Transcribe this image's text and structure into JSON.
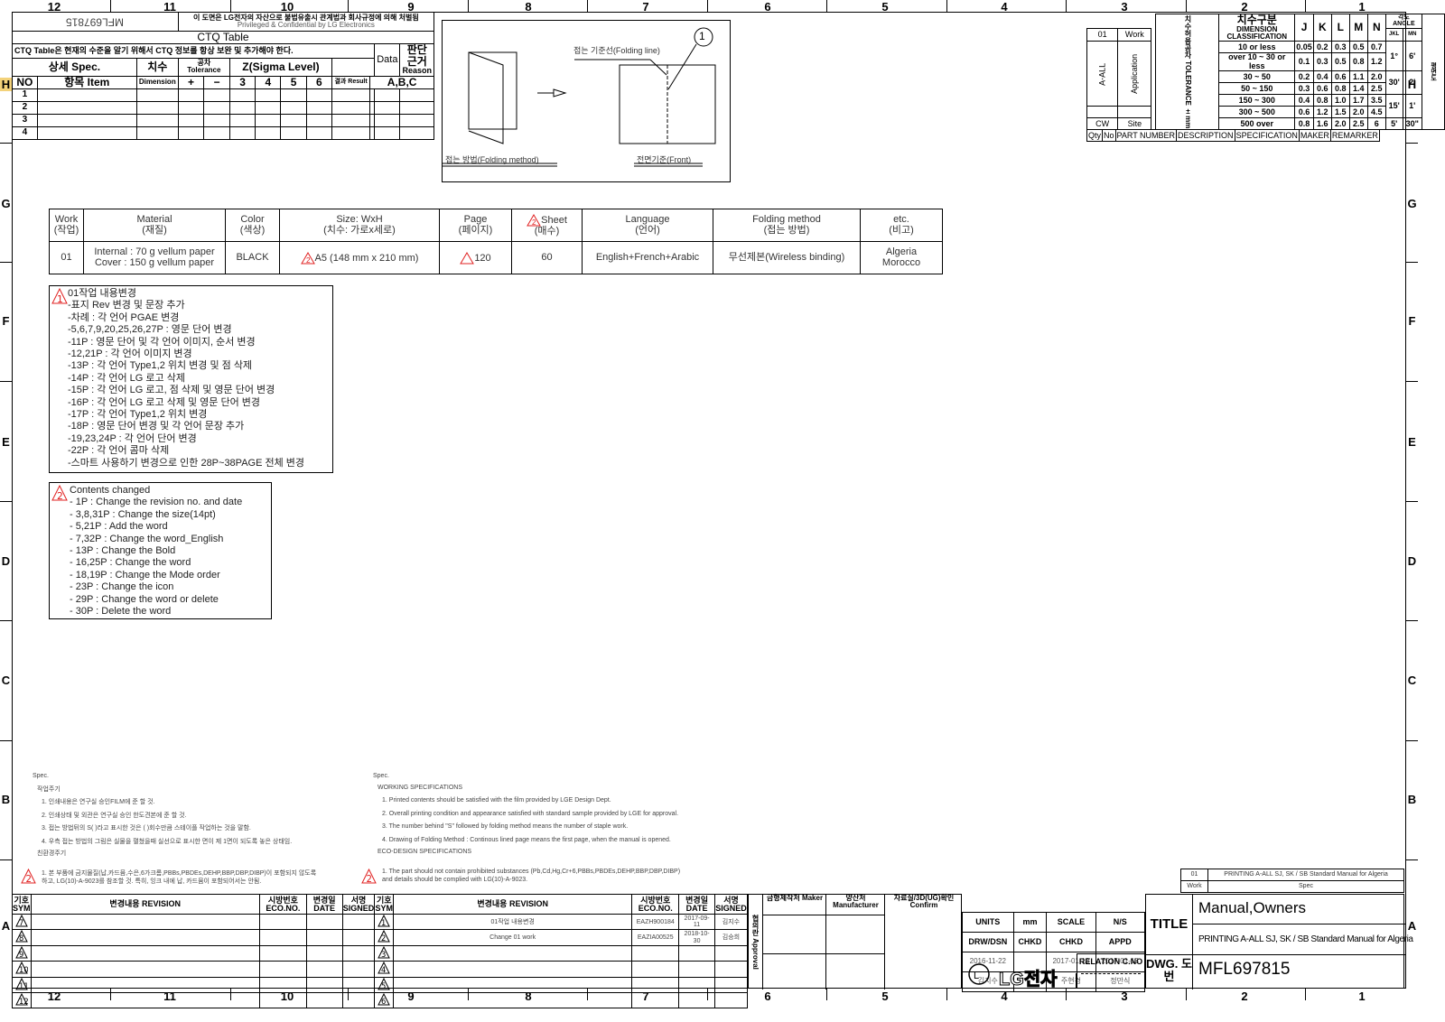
{
  "border": {
    "columns": [
      "12",
      "11",
      "10",
      "9",
      "8",
      "7",
      "6",
      "5",
      "4",
      "3",
      "2",
      "1"
    ],
    "rows": [
      "H",
      "G",
      "F",
      "E",
      "D",
      "C",
      "B",
      "A"
    ]
  },
  "ctq": {
    "drawing_no_mirrored": "MFL697815",
    "notice_ko": "이 도면은 LG전자의 자산으로 불법유출시 관계법과 회사규정에 의해 처벌됨",
    "notice_en": "Privileged & Confidential by LG Electronics",
    "title": "CTQ Table",
    "instruction": "CTQ Table은 현재의 수준을 알기 위해서 CTQ 정보를 항상 보완 및 추가해야 한다.",
    "data": "Data",
    "reason_ko": "판단근거",
    "reason_en": "Reason",
    "detail_spec": "상세 Spec.",
    "dim_ko": "치수",
    "tolerance": "공차 Tolerance",
    "sigma": "Z(Sigma Level)",
    "no": "NO",
    "item": "항목 Item",
    "dimension": "Dimension",
    "plus": "+",
    "minus": "−",
    "s3": "3",
    "s4": "4",
    "s5": "5",
    "s6": "6",
    "result": "결과 Result",
    "abc": "A,B,C",
    "rows": [
      "1",
      "2",
      "3",
      "4"
    ]
  },
  "folding": {
    "line_label": "접는 기준선(Folding line)",
    "callout": "1",
    "method_label": "접는 방법(Folding method)",
    "front_label": "전면기준(Front)"
  },
  "tolerance": {
    "work_no": "01",
    "work": "Work",
    "a_all": "A-ALL",
    "application": "Application",
    "cw": "CW",
    "site": "Site",
    "tol_ko": "치수허용공차",
    "tol_en": "TOLERANCE",
    "unit": "±mm",
    "dim_ko": "치수구분",
    "dim_en": "DIMENSION CLASSIFICATION",
    "grades": [
      "J",
      "K",
      "L",
      "M",
      "N"
    ],
    "angle": "각도 ANGLE",
    "angle_sub": [
      "JKL",
      "MN"
    ],
    "flat": "평면도",
    "ranges": [
      {
        "range": "10 or less",
        "v": [
          "0.05",
          "0.2",
          "0.3",
          "0.5",
          "0.7"
        ]
      },
      {
        "range": "over 10 ~ 30 or less",
        "v": [
          "0.1",
          "0.3",
          "0.5",
          "0.8",
          "1.2"
        ]
      },
      {
        "range": "30 ~ 50",
        "v": [
          "0.2",
          "0.4",
          "0.6",
          "1.1",
          "2.0"
        ]
      },
      {
        "range": "50 ~ 150",
        "v": [
          "0.3",
          "0.6",
          "0.8",
          "1.4",
          "2.5"
        ]
      },
      {
        "range": "150 ~ 300",
        "v": [
          "0.4",
          "0.8",
          "1.0",
          "1.7",
          "3.5"
        ]
      },
      {
        "range": "300 ~ 500",
        "v": [
          "0.6",
          "1.2",
          "1.5",
          "2.0",
          "4.5"
        ]
      },
      {
        "range": "500 over",
        "v": [
          "0.8",
          "1.6",
          "2.0",
          "2.5",
          "6"
        ]
      }
    ],
    "angles": [
      [
        "1°",
        "6'"
      ],
      [
        "30'",
        "2'"
      ],
      [
        "15'",
        "1'"
      ],
      [
        "5'",
        "30\""
      ]
    ],
    "footer": [
      "Qty",
      "No",
      "PART NUMBER",
      "DESCRIPTION",
      "SPECIFICATION",
      "MAKER",
      "REMARKER"
    ]
  },
  "spec_table": {
    "headers": [
      [
        "Work",
        "(작업)"
      ],
      [
        "Material",
        "(재질)"
      ],
      [
        "Color",
        "(색상)"
      ],
      [
        "Size: WxH",
        "(치수: 가로x세로)"
      ],
      [
        "Page",
        "(페이지)"
      ],
      [
        "Sheet",
        "(매수)"
      ],
      [
        "Language",
        "(언어)"
      ],
      [
        "Folding method",
        "(접는 방법)"
      ],
      [
        "etc.",
        "(비고)"
      ]
    ],
    "row": {
      "work": "01",
      "material": [
        "Internal : 70 g vellum paper",
        "Cover : 150 g vellum paper"
      ],
      "color": "BLACK",
      "size": "A5 (148 mm x 210 mm)",
      "page": "120",
      "sheet": "60",
      "language": "English+French+Arabic",
      "folding": "무선제본(Wireless binding)",
      "etc": [
        "Algeria",
        "Morocco"
      ]
    }
  },
  "changes_ko": {
    "rev": "1",
    "title": "01작업 내용변경",
    "items": [
      "-표지 Rev 변경 및 문장 추가",
      "-차례 : 각 언어 PGAE 변경",
      "-5,6,7,9,20,25,26,27P : 영문 단어 변경",
      "-11P : 영문 단어 및 각 언어 이미지, 순서 변경",
      "-12,21P : 각 언어 이미지 변경",
      "-13P : 각 언어 Type1,2 위치 변경 및 점 삭제",
      "-14P : 각 언어 LG 로고 삭제",
      "-15P : 각 언어 LG 로고, 점 삭제 및 영문 단어 변경",
      "-16P : 각 언어 LG 로고 삭제 및 영문 단어 변경",
      "-17P : 각 언어 Type1,2 위치 변경",
      "-18P : 영문 단어 변경 및 각 언어 문장 추가",
      "-19,23,24P : 각 언어 단어 변경",
      "-22P : 각 언어 콤마 삭제",
      "-스마트 사용하기 변경으로 인한 28P~38PAGE 전체 변경"
    ]
  },
  "changes_en": {
    "rev": "2",
    "title": "Contents changed",
    "items": [
      "- 1P : Change the revision no. and date",
      "- 3,8,31P : Change the size(14pt)",
      "- 5,21P : Add the word",
      "- 7,32P : Change the word_English",
      "- 13P : Change the Bold",
      "- 16,25P : Change the word",
      "- 18,19P : Change the Mode order",
      "- 23P : Change the icon",
      "- 29P : Change the word or delete",
      "- 30P : Delete the word"
    ]
  },
  "notes_ko": {
    "spec": "Spec.",
    "heading": "작업주기",
    "items": [
      "1. 인쇄내용은 연구실 승인FILM에 준 할 것.",
      "2. 인쇄상태 및 외관은 연구실 승인 한도견본에 준 할 것.",
      "3. 접는 방법뒤의 S( )라고 표시한 것은 ( )회수만큼 스테이플 작업하는 것을 말함.",
      "4. 우측 접는 방법의 그림은 실물을 펼쳤을때 실선으로 표시한 면이 제 1면이 되도록  놓은 상태임."
    ],
    "eco_heading": "친환경주기",
    "eco": [
      "1. 본 부품에 금지물질(납,카드뮴,수은,6가크롬,PBBs,PBDEs,DEHP,BBP,DBP,DIBP)이 포함되지 않도록",
      "하고,   LG(10)-A-9023를 참조할 것. 특히, 잉크 내에 납, 카드뮴이 포함되어서는 안됨."
    ]
  },
  "notes_en": {
    "spec": "Spec.",
    "heading": "WORKING SPECIFICATIONS",
    "items": [
      "1. Printed contents should be satisfied with the film provided by LGE Design Dept.",
      "2. Overall printing condition and appearance satisfied with standard sample provided by LGE for approval.",
      "3. The number behind \"S\" followed by folding method means the number of   staple work.",
      "4. Drawing of Folding Method : Continous lined page means the first page, when   the manual is opened."
    ],
    "eco_heading": "ECO-DESIGN SPECIFICATIONS",
    "eco": [
      "1.  The part should not contain prohibited substances (Pb,Cd,Hg,Cr+6,PBBs,PBDEs,DEHP,BBP,DBP,DIBP)",
      "and details should be complied with LG(10)-A-9023."
    ]
  },
  "work_spec": {
    "no": "01",
    "spec": "PRINTING A-ALL SJ, SK / SB Standard Manual for Algeria",
    "work": "Work",
    "spec_label": "Spec"
  },
  "revision": {
    "headers": {
      "sym": "기호 SYM",
      "revision": "변경내용 REVISION",
      "eco": "시방번호 ECO.NO.",
      "date": "변경일 DATE",
      "signed": "서명 SIGNED"
    },
    "left_syms": [
      "7",
      "8",
      "9",
      "10",
      "11",
      "12"
    ],
    "right": [
      {
        "sym": "1",
        "revision": "01작업 내용변경",
        "eco": "EAZH900184",
        "date": "2017-09-11",
        "signed": "김지수"
      },
      {
        "sym": "2",
        "revision": "Change 01 work",
        "eco": "EAZIA00525",
        "date": "2018-10-30",
        "signed": "김승희"
      },
      {
        "sym": "3",
        "revision": "",
        "eco": "",
        "date": "",
        "signed": ""
      },
      {
        "sym": "4",
        "revision": "",
        "eco": "",
        "date": "",
        "signed": ""
      },
      {
        "sym": "5",
        "revision": "",
        "eco": "",
        "date": "",
        "signed": ""
      },
      {
        "sym": "6",
        "revision": "",
        "eco": "",
        "date": "",
        "signed": ""
      }
    ]
  },
  "approval": {
    "label": "협의란 Approval",
    "maker": "금형제작처 Maker",
    "manufacturer": "양산처 Manufacturer",
    "confirm": "자료실/3D(UG)확인 Confirm"
  },
  "title_block": {
    "units": "UNITS",
    "mm": "mm",
    "scale": "SCALE",
    "ns": "N/S",
    "drw": "DRW/DSN",
    "chkd1": "CHKD",
    "chkd2": "CHKD",
    "appd": "APPD",
    "drw_date": "2016-11-22",
    "chkd2_date": "2017-01-13",
    "appd_date": "2017-01-13",
    "drw_name": "김지수",
    "chkd2_name": "주현경",
    "appd_name": "정만식",
    "logo": "LG전자",
    "relation": "RELATION C.NO",
    "title_label": "TITLE",
    "title": "Manual,Owners",
    "subtitle": "PRINTING A-ALL SJ, SK / SB Standard Manual for Algeria",
    "dwg_label": "DWG. 도번",
    "dwg_no": "MFL697815"
  },
  "colors": {
    "revision_triangle": "#e02020",
    "line": "#000000"
  }
}
